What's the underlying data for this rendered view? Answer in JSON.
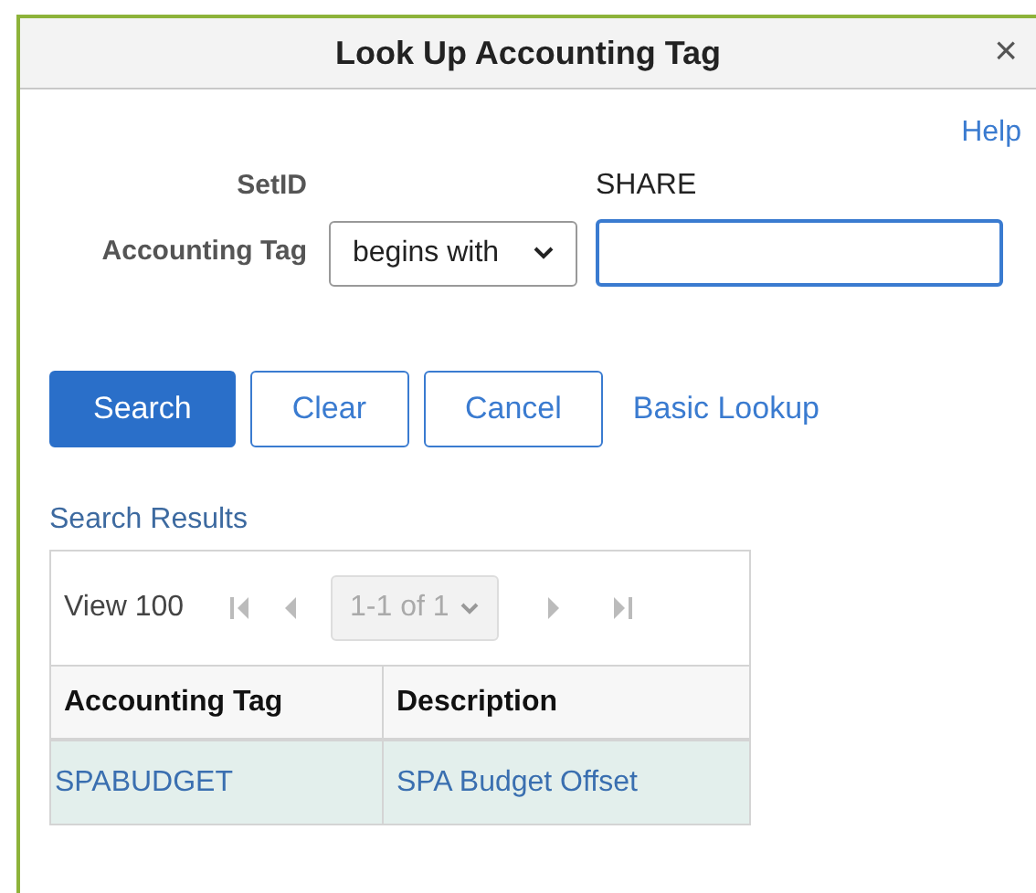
{
  "dialog": {
    "title": "Look Up Accounting Tag",
    "close": "×",
    "help": "Help"
  },
  "setid": {
    "label": "SetID",
    "value": "SHARE"
  },
  "criteria": {
    "label": "Accounting Tag",
    "operator": "begins with",
    "focused": true
  },
  "buttons": [
    {
      "label": "Search",
      "kind": "primary"
    },
    {
      "label": "Clear",
      "kind": "secondary"
    },
    {
      "label": "Cancel",
      "kind": "secondary"
    },
    {
      "label": "Basic Lookup",
      "kind": "link"
    }
  ],
  "results": {
    "title": "Search Results",
    "view": "View 100",
    "pager": "1-1 of 1",
    "nav_disabled": true,
    "columns": [
      "Accounting Tag",
      "Description"
    ],
    "rows": [
      {
        "cells": [
          "SPABUDGET",
          "SPA Budget Offset"
        ],
        "selected": true
      }
    ]
  }
}
